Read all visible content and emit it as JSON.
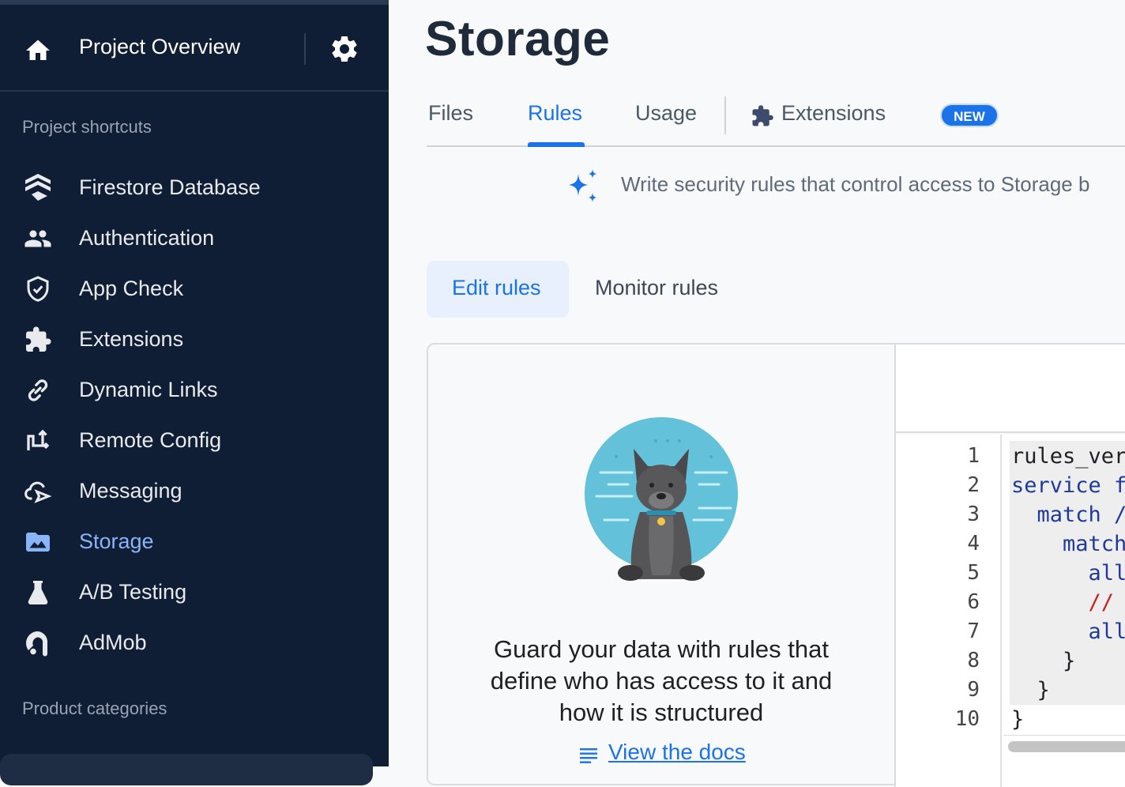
{
  "sidebar": {
    "project_title": "Project Overview",
    "shortcuts_label": "Project shortcuts",
    "categories_label": "Product categories",
    "items": [
      {
        "label": "Firestore Database",
        "icon": "firestore-icon"
      },
      {
        "label": "Authentication",
        "icon": "people-icon"
      },
      {
        "label": "App Check",
        "icon": "shield-icon"
      },
      {
        "label": "Extensions",
        "icon": "puzzle-icon"
      },
      {
        "label": "Dynamic Links",
        "icon": "link-icon"
      },
      {
        "label": "Remote Config",
        "icon": "remote-config-icon"
      },
      {
        "label": "Messaging",
        "icon": "cloud-send-icon"
      },
      {
        "label": "Storage",
        "icon": "image-folder-icon",
        "active": true
      },
      {
        "label": "A/B Testing",
        "icon": "flask-icon"
      },
      {
        "label": "AdMob",
        "icon": "admob-icon"
      }
    ]
  },
  "main": {
    "title": "Storage",
    "tabs": [
      {
        "label": "Files"
      },
      {
        "label": "Rules",
        "active": true
      },
      {
        "label": "Usage"
      },
      {
        "label": "Extensions",
        "badge": "NEW"
      }
    ],
    "info_text": "Write security rules that control access to Storage b",
    "subtabs": [
      {
        "label": "Edit rules",
        "active": true
      },
      {
        "label": "Monitor rules"
      }
    ],
    "card": {
      "headline": "Guard your data with rules that define who has access to it and how it is structured",
      "headline_lines": [
        "Guard your data with rules that",
        "define who has access to it and",
        "how it is structured"
      ],
      "docs_link": "View the docs"
    },
    "editor": {
      "line_numbers": [
        "1",
        "2",
        "3",
        "4",
        "5",
        "6",
        "7",
        "8",
        "9",
        "10"
      ],
      "lines": [
        "rules_ver",
        "service f",
        "  match /",
        "    match",
        "      all",
        "      //",
        "      all",
        "    }",
        "  }",
        "}"
      ]
    }
  },
  "colors": {
    "sidebar_bg": "#0f1e35",
    "accent": "#1a73e8",
    "active_nav": "#8ab4f8"
  }
}
